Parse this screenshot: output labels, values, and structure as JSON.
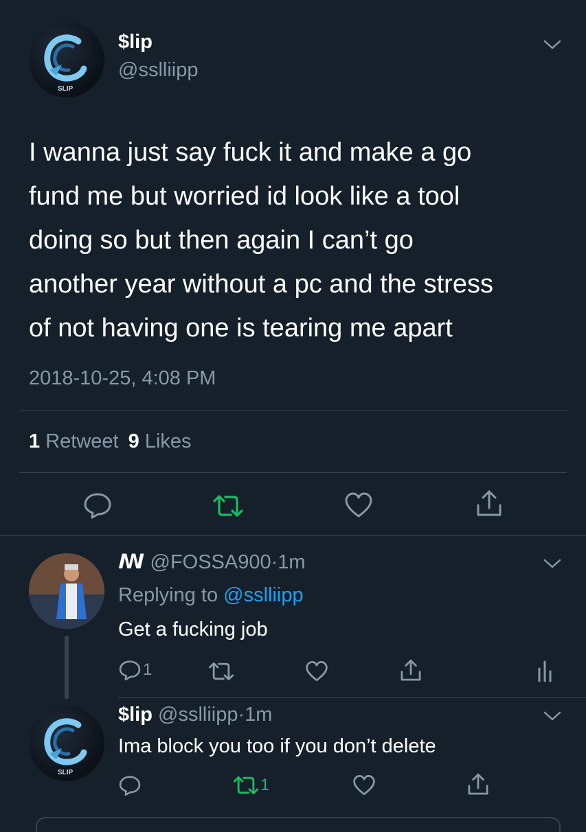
{
  "main_tweet": {
    "author_name": "$lip",
    "author_handle": "@sslliipp",
    "avatar_text": "SLIP",
    "text_lines": [
      "I wanna just say fuck it and make a go",
      "fund me but worried id look like a tool",
      "doing so but then again I can’t go",
      "another year without a pc and the stress",
      "of not having one is tearing me apart"
    ],
    "timestamp": "2018-10-25, 4:08 PM",
    "retweet_count": "1",
    "retweet_label": "Retweet",
    "like_count": "9",
    "like_label": "Likes"
  },
  "reply1": {
    "author_name": "ꟿ",
    "author_handle": "@FOSSA900",
    "separator": "·",
    "time": "1m",
    "replying_prefix": "Replying to",
    "replying_to": "@sslliipp",
    "text": "Get a fucking job",
    "reply_count": "1"
  },
  "reply2": {
    "author_name": "$lip",
    "author_handle": "@sslliipp",
    "separator": "·",
    "time": "1m",
    "avatar_text": "SLIP",
    "text": "Ima block you too if you don’t delete",
    "retweet_count": "1"
  },
  "colors": {
    "background": "#15202b",
    "muted": "#8899a6",
    "link": "#1da1f2",
    "retweet_green": "#17bf63",
    "divider": "#38444d"
  },
  "icons": [
    "chevron-down-icon",
    "reply-icon",
    "retweet-icon",
    "like-icon",
    "share-icon",
    "analytics-icon"
  ]
}
